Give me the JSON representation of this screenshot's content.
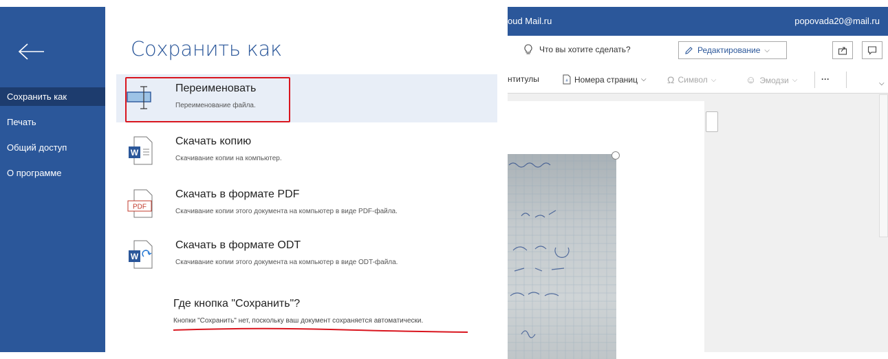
{
  "sidebar": {
    "items": [
      {
        "label": "Сохранить как"
      },
      {
        "label": "Печать"
      },
      {
        "label": "Общий доступ"
      },
      {
        "label": "О программе"
      }
    ]
  },
  "panel": {
    "title": "Сохранить как",
    "options": [
      {
        "title": "Переименовать",
        "desc": "Переименование файла."
      },
      {
        "title": "Скачать копию",
        "desc": "Скачивание копии на компьютер."
      },
      {
        "title": "Скачать в формате PDF",
        "desc": "Скачивание копии этого документа на компьютер в виде PDF-файла.",
        "icon_text": "PDF"
      },
      {
        "title": "Скачать в формате ODT",
        "desc": "Скачивание копии этого документа на компьютер в виде ODT-файла."
      }
    ],
    "where": {
      "title": "Где кнопка \"Сохранить\"?",
      "desc": "Кнопки \"Сохранить\" нет, поскольку ваш документ сохраняется автоматически."
    }
  },
  "doc": {
    "app_name": "oud Mail.ru",
    "user_email": "popovada20@mail.ru",
    "tell_me": "Что вы хотите сделать?",
    "edit_label": "Редактирование",
    "ribbon": {
      "headers": "нтитулы",
      "page_numbers": "Номера страниц",
      "symbol": "Символ",
      "emoji": "Эмодзи",
      "more": "···"
    }
  },
  "colors": {
    "accent": "#2b579a",
    "highlight": "#d9151e",
    "selected_bg": "#e8eef7"
  }
}
